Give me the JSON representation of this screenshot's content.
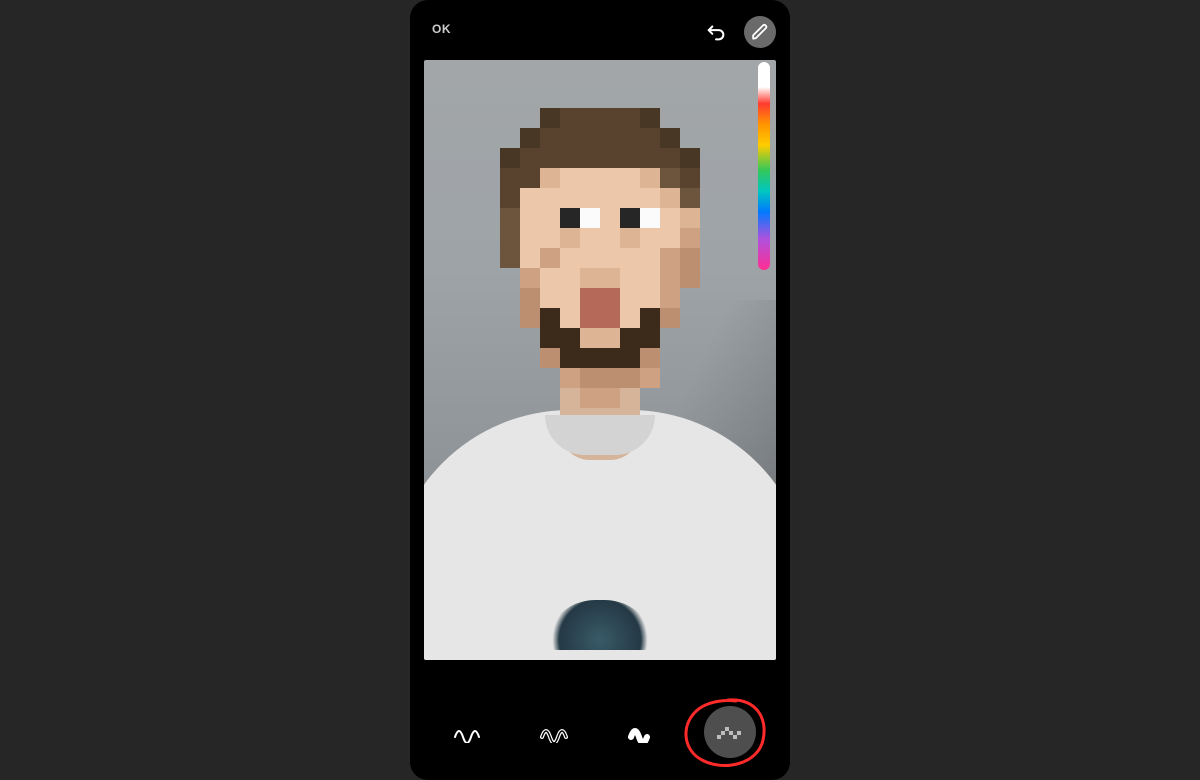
{
  "header": {
    "ok_label": "OK",
    "undo_icon": "undo-icon",
    "edit_icon": "pencil-icon"
  },
  "color_slider": {
    "gradient": [
      "#ffffff",
      "#ff3b30",
      "#ff9500",
      "#ffcc00",
      "#34c759",
      "#00c7be",
      "#007aff",
      "#af52de",
      "#ff2d92"
    ]
  },
  "toolbar": {
    "tools": [
      {
        "id": "brush-normal",
        "icon": "squiggle-thin-icon",
        "selected": false
      },
      {
        "id": "brush-outline",
        "icon": "squiggle-outline-icon",
        "selected": false
      },
      {
        "id": "brush-neon",
        "icon": "squiggle-bold-icon",
        "selected": false
      },
      {
        "id": "brush-mosaic",
        "icon": "squiggle-pixel-icon",
        "selected": true
      }
    ]
  },
  "canvas": {
    "effect": "pixelate-face",
    "subject": "person-portrait"
  },
  "annotation": {
    "highlight_tool_index": 3,
    "color": "#ff2a2a"
  }
}
